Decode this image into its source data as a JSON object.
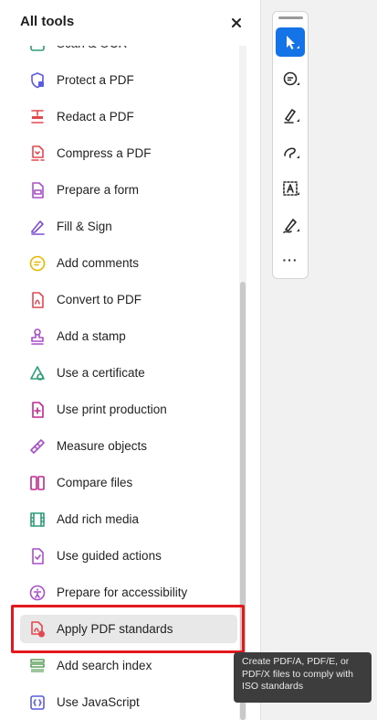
{
  "panel": {
    "title": "All tools",
    "close_label": "×"
  },
  "tools": [
    {
      "label": "Scan & OCR",
      "icon": "scan-ocr-icon",
      "color": "#2d9d78"
    },
    {
      "label": "Protect a PDF",
      "icon": "protect-pdf-icon",
      "color": "#5c5ce0"
    },
    {
      "label": "Redact a PDF",
      "icon": "redact-pdf-icon",
      "color": "#e34850"
    },
    {
      "label": "Compress a PDF",
      "icon": "compress-pdf-icon",
      "color": "#e34850"
    },
    {
      "label": "Prepare a form",
      "icon": "prepare-form-icon",
      "color": "#a94fc9"
    },
    {
      "label": "Fill & Sign",
      "icon": "fill-sign-icon",
      "color": "#7e4fd4"
    },
    {
      "label": "Add comments",
      "icon": "add-comments-icon",
      "color": "#e6b800"
    },
    {
      "label": "Convert to PDF",
      "icon": "convert-pdf-icon",
      "color": "#e34850"
    },
    {
      "label": "Add a stamp",
      "icon": "stamp-icon",
      "color": "#a94fc9"
    },
    {
      "label": "Use a certificate",
      "icon": "certificate-icon",
      "color": "#2d9d78"
    },
    {
      "label": "Use print production",
      "icon": "print-production-icon",
      "color": "#c0298f"
    },
    {
      "label": "Measure objects",
      "icon": "measure-icon",
      "color": "#a94fc9"
    },
    {
      "label": "Compare files",
      "icon": "compare-files-icon",
      "color": "#c0298f"
    },
    {
      "label": "Add rich media",
      "icon": "rich-media-icon",
      "color": "#2d9d78"
    },
    {
      "label": "Use guided actions",
      "icon": "guided-actions-icon",
      "color": "#a94fc9"
    },
    {
      "label": "Prepare for accessibility",
      "icon": "accessibility-icon",
      "color": "#a94fc9"
    },
    {
      "label": "Apply PDF standards",
      "icon": "pdf-standards-icon",
      "color": "#e34850",
      "active": true
    },
    {
      "label": "Add search index",
      "icon": "search-index-icon",
      "color": "#5fa05f"
    },
    {
      "label": "Use JavaScript",
      "icon": "javascript-icon",
      "color": "#5c5ce0"
    }
  ],
  "toolbar": {
    "accent": "#1473e6",
    "buttons": [
      {
        "icon": "select-cursor-icon",
        "selected": true
      },
      {
        "icon": "comment-icon",
        "selected": false
      },
      {
        "icon": "highlighter-icon",
        "selected": false
      },
      {
        "icon": "freehand-draw-icon",
        "selected": false
      },
      {
        "icon": "text-box-icon",
        "selected": false
      },
      {
        "icon": "signature-icon",
        "selected": false
      }
    ],
    "more_label": "···"
  },
  "tooltip": {
    "text": "Create PDF/A, PDF/E, or PDF/X files to comply with ISO standards"
  },
  "colors": {
    "highlight": "#e3191e",
    "tooltip_bg": "#3d3d3d"
  }
}
